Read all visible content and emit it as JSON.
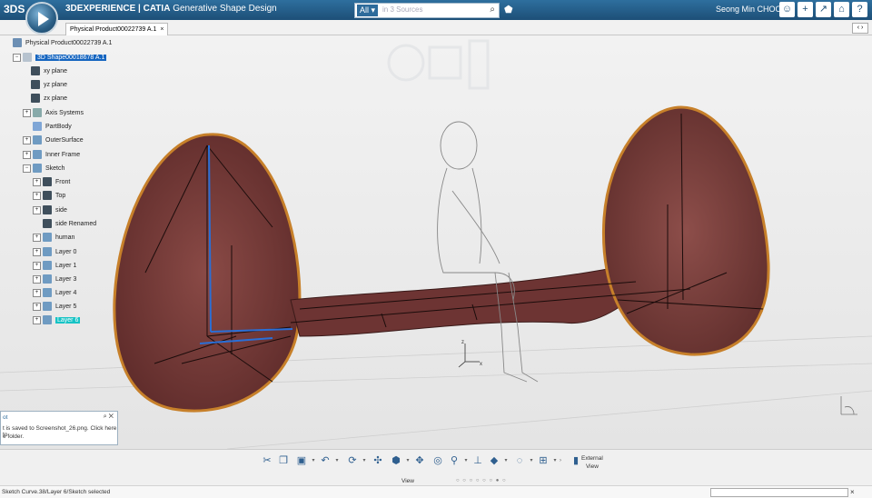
{
  "header": {
    "brand": "3DEXPERIENCE | CATIA",
    "app": "Generative Shape Design",
    "search_scope": "All",
    "search_placeholder": "in 3 Sources",
    "user": "Seong Min CHOO",
    "icons": [
      "ds-logo-icon",
      "compass-play-icon",
      "search-icon",
      "tag-icon",
      "person-icon",
      "plus-icon",
      "share-icon",
      "home-icon",
      "help-icon"
    ]
  },
  "tab": {
    "label": "Physical Product00022739 A.1",
    "close": "×"
  },
  "tree": {
    "nodes": [
      {
        "label": "Physical Product00022739 A.1",
        "icon": "product-icon"
      },
      {
        "label": "3D Shape00018678 A.1",
        "icon": "shape-icon"
      },
      {
        "label": "xy plane",
        "icon": "plane-icon"
      },
      {
        "label": "yz plane",
        "icon": "plane-icon"
      },
      {
        "label": "zx plane",
        "icon": "plane-icon"
      },
      {
        "label": "Axis Systems",
        "icon": "axis-icon"
      },
      {
        "label": "PartBody",
        "icon": "partbody-icon"
      },
      {
        "label": "OuterSurface",
        "icon": "geoset-icon"
      },
      {
        "label": "Inner Frame",
        "icon": "geoset-icon"
      },
      {
        "label": "Sketch",
        "icon": "geoset-icon"
      },
      {
        "label": "Front",
        "icon": "sketch-icon"
      },
      {
        "label": "Top",
        "icon": "sketch-icon"
      },
      {
        "label": "side",
        "icon": "sketch-icon"
      },
      {
        "label": "side Renamed",
        "icon": "sketch-icon"
      },
      {
        "label": "human",
        "icon": "geoset-icon"
      },
      {
        "label": "Layer 0",
        "icon": "geoset-icon"
      },
      {
        "label": "Layer 1",
        "icon": "geoset-icon"
      },
      {
        "label": "Layer 3",
        "icon": "geoset-icon"
      },
      {
        "label": "Layer 4",
        "icon": "geoset-icon"
      },
      {
        "label": "Layer 5",
        "icon": "geoset-icon"
      },
      {
        "label": "Layer 6",
        "icon": "geoset-icon"
      }
    ]
  },
  "notification": {
    "title": "ot",
    "line1": "t is saved to Screenshot_26.png. Click here to",
    "line2": "e folder."
  },
  "toolbar": {
    "section": "View",
    "external_line1": "External",
    "external_line2": "View",
    "dots": "○ ○ ○ ○ ○ ○ ●  ○"
  },
  "status": {
    "text": "Sketch Curve.38/Layer 6/Sketch selected"
  },
  "colors": {
    "header": "#1d4f77",
    "selection": "#1565c0",
    "selection_alt": "#17c3c5",
    "surface": "#7a3d3a",
    "edge": "#c7802a"
  }
}
